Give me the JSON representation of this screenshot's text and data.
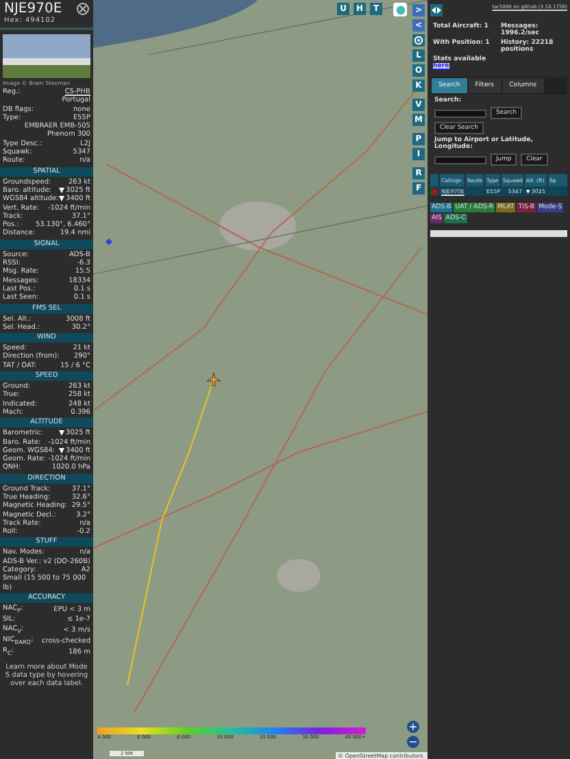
{
  "aircraft": {
    "callsign": "NJE970E",
    "hex": "Hex: 494102",
    "photo_credit": "Image © Bram Steeman"
  },
  "info_rows": [
    {
      "kind": "link",
      "label": "Reg.:",
      "value": "CS-PHB"
    },
    {
      "kind": "value",
      "value": "Portugal"
    },
    {
      "kind": "pair",
      "label": "DB flags:",
      "value": "none"
    },
    {
      "kind": "pair",
      "label": "Type:",
      "value": "E55P"
    },
    {
      "kind": "value",
      "value": "EMBRAER EMB-505 Phenom 300"
    },
    {
      "kind": "pair",
      "label": "Type Desc.:",
      "value": "L2J"
    },
    {
      "kind": "pair",
      "label": "Squawk:",
      "value": "5347"
    },
    {
      "kind": "pair",
      "label": "Route:",
      "value": "n/a"
    }
  ],
  "sections": [
    {
      "title": "SPATIAL",
      "rows": [
        {
          "label": "Groundspeed:",
          "value": "263 kt",
          "down": false
        },
        {
          "label": "Baro. altitude:",
          "value": "3025 ft",
          "down": true
        },
        {
          "label": "WGS84 altitude:",
          "value": "3400 ft",
          "down": true
        },
        {
          "label": "Vert. Rate:",
          "value": "-1024 ft/min",
          "down": false
        },
        {
          "label": "Track:",
          "value": "37.1°",
          "down": false
        },
        {
          "label": "Pos.:",
          "value": "53.130°, 6.460°",
          "down": false
        },
        {
          "label": "Distance:",
          "value": "19.4 nmi",
          "down": false
        }
      ]
    },
    {
      "title": "SIGNAL",
      "rows": [
        {
          "label": "Source:",
          "value": "ADS-B",
          "down": false
        },
        {
          "label": "RSSI:",
          "value": "-6.3",
          "down": false
        },
        {
          "label": "Msg. Rate:",
          "value": "15.5",
          "down": false
        },
        {
          "label": "Messages:",
          "value": "18334",
          "down": false
        },
        {
          "label": "Last Pos.:",
          "value": "0.1 s",
          "down": false
        },
        {
          "label": "Last Seen:",
          "value": "0.1 s",
          "down": false
        }
      ]
    },
    {
      "title": "FMS SEL",
      "rows": [
        {
          "label": "Sel. Alt.:",
          "value": "3008 ft",
          "down": false
        },
        {
          "label": "Sel. Head.:",
          "value": "30.2°",
          "down": false
        }
      ]
    },
    {
      "title": "WIND",
      "rows": [
        {
          "label": "Speed:",
          "value": "21 kt",
          "down": false
        },
        {
          "label": "Direction (from):",
          "value": "290°",
          "down": false
        },
        {
          "label": "TAT / OAT:",
          "value": "15 / 6 °C",
          "down": false
        }
      ]
    },
    {
      "title": "SPEED",
      "rows": [
        {
          "label": "Ground:",
          "value": "263 kt",
          "down": false
        },
        {
          "label": "True:",
          "value": "258 kt",
          "down": false
        },
        {
          "label": "Indicated:",
          "value": "248 kt",
          "down": false
        },
        {
          "label": "Mach:",
          "value": "0.396",
          "down": false
        }
      ]
    },
    {
      "title": "ALTITUDE",
      "rows": [
        {
          "label": "Barometric:",
          "value": "3025 ft",
          "down": true
        },
        {
          "label": "Baro. Rate:",
          "value": "-1024 ft/min",
          "down": false
        },
        {
          "label": "Geom. WGS84:",
          "value": "3400 ft",
          "down": true
        },
        {
          "label": "Geom. Rate:",
          "value": "-1024 ft/min",
          "down": false
        },
        {
          "label": "QNH:",
          "value": "1020.0 hPa",
          "down": false
        }
      ]
    },
    {
      "title": "DIRECTION",
      "rows": [
        {
          "label": "Ground Track:",
          "value": "37.1°",
          "down": false
        },
        {
          "label": "True Heading:",
          "value": "32.6°",
          "down": false
        },
        {
          "label": "Magnetic Heading:",
          "value": "29.5°",
          "down": false
        },
        {
          "label": "Magnetic Decl.:",
          "value": "3.2°",
          "down": false
        },
        {
          "label": "Track Rate:",
          "value": "n/a",
          "down": false
        },
        {
          "label": "Roll:",
          "value": "-0.2",
          "down": false
        }
      ]
    },
    {
      "title": "STUFF",
      "rows": [
        {
          "label": "Nav. Modes:",
          "value": "n/a",
          "down": false
        },
        {
          "label": "ADS-B Ver.:",
          "value": "v2 (DO-260B)",
          "down": false
        },
        {
          "label": "Category:",
          "value": "A2",
          "down": false
        },
        {
          "label": "Small (15 500 to 75 000 lb)"
        }
      ]
    },
    {
      "title": "ACCURACY",
      "rows": [
        {
          "label": "NAC$_{P}$:",
          "value": "EPU < 3 m",
          "down": false
        },
        {
          "label": "SIL:",
          "value": "≤ 1e-7",
          "down": false
        },
        {
          "label": "NAC$_{V}$:",
          "value": "< 3 m/s",
          "down": false
        },
        {
          "label": "NIC$_{BARO}$:",
          "value": "cross-checked",
          "down": false
        },
        {
          "label": "R$_{C}$:",
          "value": "186 m",
          "down": false
        }
      ]
    }
  ],
  "footer_note": "Learn more about Mode S data type by hovering over each data label.",
  "map_top_buttons": [
    "U",
    "H",
    "T"
  ],
  "map_side_buttons": [
    {
      "kind": "icon",
      "label": ">"
    },
    {
      "kind": "icon",
      "label": "<"
    },
    {
      "kind": "gear"
    },
    {
      "kind": "letter",
      "label": "L"
    },
    {
      "kind": "letter",
      "label": "O"
    },
    {
      "kind": "letter",
      "label": "K"
    },
    {
      "kind": "letter",
      "label": "V"
    },
    {
      "kind": "letter",
      "label": "M"
    },
    {
      "kind": "letter",
      "label": "P"
    },
    {
      "kind": "letter",
      "label": "I"
    },
    {
      "kind": "letter",
      "label": "R"
    },
    {
      "kind": "letter",
      "label": "F"
    }
  ],
  "legend": {
    "ticks": [
      "4 000",
      "6 000",
      "8 000",
      "10 000",
      "20 000",
      "30 000",
      "40 000+"
    ],
    "scale": "2 NM",
    "attribution": "© OpenStreetMap contributors."
  },
  "zoom_buttons": [
    "+",
    "−"
  ],
  "panel": {
    "version_link": "tar1090 on github (3.14.1758)",
    "total": "Total Aircraft: 1",
    "messages": "Messages: 1996.2/sec",
    "with_position": "With Position: 1",
    "history": "History: 22218 positions",
    "stats": "Stats available",
    "stats_link": "here",
    "tabs": [
      {
        "label": "Search",
        "selected": true
      },
      {
        "label": "Filters",
        "selected": false
      },
      {
        "label": "Columns",
        "selected": false
      }
    ],
    "search_label": "Search:",
    "search_button": "Search",
    "clear_search": "Clear Search",
    "jump_label": "Jump to Airport or Latitude, Longitude:",
    "jump_button": "Jump",
    "clear_button": "Clear",
    "columns": [
      "Callsign",
      "Route",
      "Type",
      "Squawk",
      "Alt. (ft)",
      "Sp"
    ],
    "rows": [
      {
        "callsign": "NJE970E",
        "type": "E55P",
        "squawk": "5347",
        "alt": "3025",
        "down": true
      }
    ],
    "badges": [
      {
        "label": "ADS-B",
        "color": "#1e6f8a"
      },
      {
        "label": "UAT / ADS-R",
        "color": "#2b7a3a"
      },
      {
        "label": "MLAT",
        "color": "#7a6a1e"
      },
      {
        "label": "TIS-B",
        "color": "#7a2140"
      },
      {
        "label": "Mode-S",
        "color": "#3d3a8a"
      },
      {
        "label": "AIS",
        "color": "#6a2a6e"
      },
      {
        "label": "ADS-C",
        "color": "#1f6e4a"
      }
    ]
  }
}
